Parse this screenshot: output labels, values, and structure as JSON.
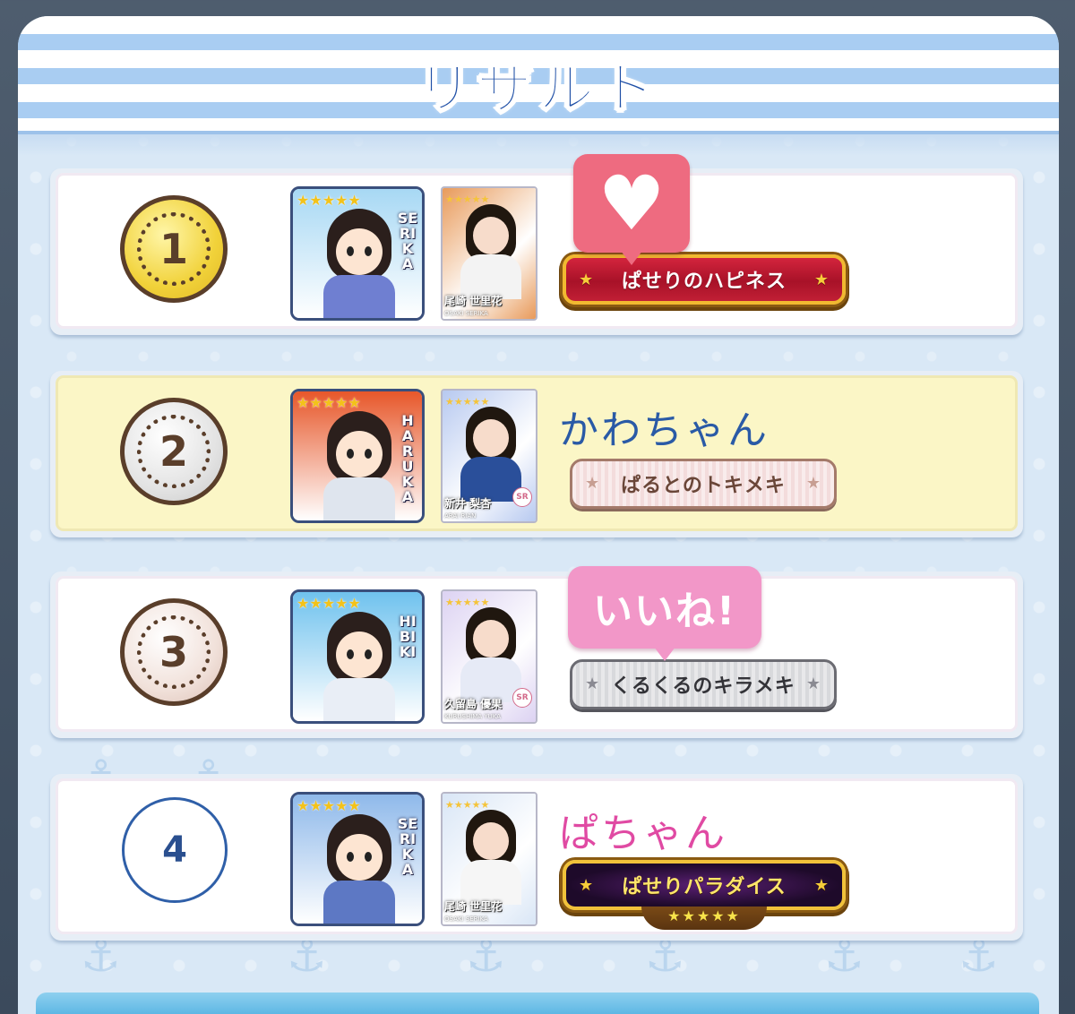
{
  "title": "リザルト",
  "results": [
    {
      "rank": "1",
      "medal": "gold",
      "avatar": {
        "name": "SERIKA",
        "stars": "★★★★★",
        "bg": "#a7d8f4",
        "outfit": "#6f7fd1"
      },
      "card": {
        "name": "尾崎 世里花",
        "roman": "OSAKI SERIKA",
        "stars": "★★★★★",
        "bg": "#e89a5a",
        "outfit": "#f3f3f3"
      },
      "player_name": "",
      "player_color": "#1f4fa6",
      "badge": {
        "label": "ぱせりのハピネス",
        "style": "red",
        "star_left": "★",
        "star_right": "★"
      },
      "bubble": {
        "type": "heart",
        "text": "♥"
      }
    },
    {
      "rank": "2",
      "medal": "silver",
      "avatar": {
        "name": "HARUKA",
        "stars": "★★★★★",
        "bg": "#e7572a",
        "outfit": "#dfe5ee"
      },
      "card": {
        "name": "新井 梨杏",
        "roman": "ARAI RIAN",
        "stars": "★★★★★",
        "bg": "#b7c9f0",
        "outfit": "#2a4f9a",
        "sr": "SR"
      },
      "player_name": "かわちゃん",
      "player_color": "#2a5aa6",
      "badge": {
        "label": "ぱるとのトキメキ",
        "style": "pink",
        "star_left": "★",
        "star_right": "★"
      }
    },
    {
      "rank": "3",
      "medal": "bronze",
      "avatar": {
        "name": "HIBIKI",
        "stars": "★★★★★",
        "bg": "#6fc2ee",
        "outfit": "#e9eef6"
      },
      "card": {
        "name": "久留島 優果",
        "roman": "KURUSHIMA YUKA",
        "stars": "★★★★★",
        "bg": "#dcd2f2",
        "outfit": "#e6eaf6",
        "sr": "SR"
      },
      "player_name": "",
      "player_color": "#1f4fa6",
      "badge": {
        "label": "くるくるのキラメキ",
        "style": "silver",
        "star_left": "★",
        "star_right": "★"
      },
      "bubble": {
        "type": "like",
        "text": "いいね!"
      }
    },
    {
      "rank": "4",
      "medal": "none",
      "avatar": {
        "name": "SERIKA",
        "stars": "★★★★★",
        "bg": "#8fb9ea",
        "outfit": "#5d78c4"
      },
      "card": {
        "name": "尾崎 世里花",
        "roman": "OSAKI SERIKA",
        "stars": "★★★★★",
        "bg": "#d9e6f6",
        "outfit": "#f6f6f6"
      },
      "player_name": "ぱちゃん",
      "player_color": "#e04aa3",
      "badge": {
        "label": "ぱせりパラダイス",
        "style": "purple",
        "star_left": "★",
        "star_right": "★",
        "sub_stars": "★★★★★"
      }
    }
  ]
}
